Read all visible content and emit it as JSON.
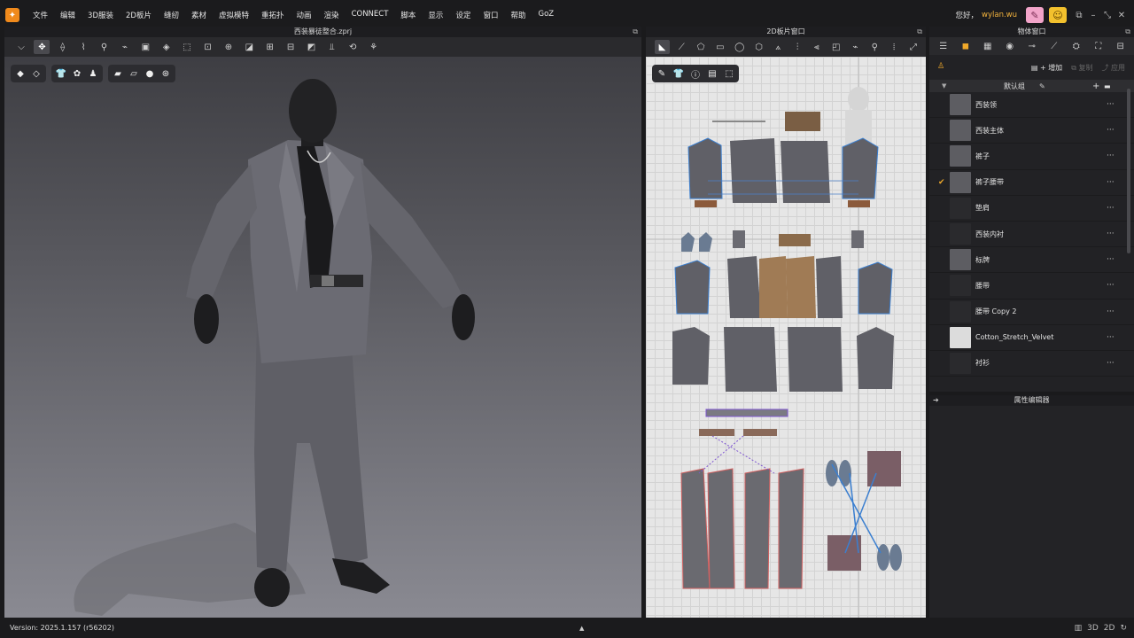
{
  "menubar": {
    "logo_glyph": "✦",
    "items": [
      "文件",
      "编辑",
      "3D服装",
      "2D板片",
      "缝纫",
      "素材",
      "虚拟模特",
      "重拓扑",
      "动画",
      "渲染",
      "CONNECT",
      "脚本",
      "显示",
      "设定",
      "窗口",
      "帮助",
      "GoZ"
    ],
    "greeting": "您好，",
    "username": "wylan.wu",
    "accent": "#f08a1c"
  },
  "viewport3d": {
    "title": "西装暴徒整合.zprj",
    "toolbar_icons": [
      "select-mesh-icon",
      "move-gizmo-icon",
      "fold-icon",
      "steam-icon",
      "pin-icon",
      "tape-icon",
      "box-pin-icon",
      "select-pin-icon",
      "transform-pattern-icon",
      "fit-avatar-icon",
      "punch-icon",
      "edit-pattern-icon",
      "measure-icon",
      "avatar-measure-icon",
      "fabric-icon",
      "align-icon",
      "keyframe-icon",
      "walk-icon"
    ],
    "sub_icons_a": [
      "shading-icon",
      "texture-icon"
    ],
    "sub_icons_b": [
      "garment-icon",
      "pattern-outline-icon",
      "avatar-icon"
    ],
    "sub_icons_c": [
      "fabric-show-icon",
      "layer-icon",
      "avatar-show-icon",
      "globe-icon"
    ]
  },
  "pattern2d": {
    "title": "2D板片窗口",
    "toolbar_icons": [
      "edit-pattern-2d-icon",
      "transform-2d-icon",
      "polygon-icon",
      "rectangle-icon",
      "circle-icon",
      "internal-polygon-icon",
      "dart-icon",
      "segment-sew-icon",
      "free-sew-icon",
      "fold-arrange-icon",
      "tape-2d-icon",
      "pin-2d-icon",
      "edit-texture-icon",
      "sew-line-icon"
    ],
    "sub_icons": [
      "pencil-icon",
      "shirt-icon",
      "info-icon",
      "layer-2d-icon",
      "shirt-select-icon"
    ]
  },
  "object_window": {
    "title": "物体窗口",
    "tabs": [
      "list-icon",
      "hanger-icon",
      "grid-icon",
      "button-icon",
      "buttonhole-icon",
      "topstitch-icon",
      "trim-icon",
      "puckering-icon",
      "zipper-icon"
    ],
    "add_label": "增加",
    "copy_label": "复制",
    "apply_label": "应用",
    "group_name": "默认组",
    "fabrics": [
      {
        "name": "西装领",
        "color": "#5d5d62",
        "checked": false
      },
      {
        "name": "西装主体",
        "color": "#5d5d62",
        "checked": false
      },
      {
        "name": "裤子",
        "color": "#5d5d62",
        "checked": false
      },
      {
        "name": "裤子腰带",
        "color": "#5d5d62",
        "checked": true
      },
      {
        "name": "垫肩",
        "color": "#2a2a2d",
        "checked": false
      },
      {
        "name": "西装内衬",
        "color": "#2a2a2d",
        "checked": false
      },
      {
        "name": "标牌",
        "color": "#5d5d62",
        "checked": false
      },
      {
        "name": "腰带",
        "color": "#2a2a2d",
        "checked": false
      },
      {
        "name": "腰带 Copy 2",
        "color": "#2a2a2d",
        "checked": false
      },
      {
        "name": "Cotton_Stretch_Velvet",
        "color": "#dcdcdc",
        "checked": false
      },
      {
        "name": "衬衫",
        "color": "#2a2a2d",
        "checked": false
      }
    ]
  },
  "property_editor": {
    "title": "属性编辑器"
  },
  "status": {
    "version": "Version: 2025.1.157 (r56202)"
  }
}
